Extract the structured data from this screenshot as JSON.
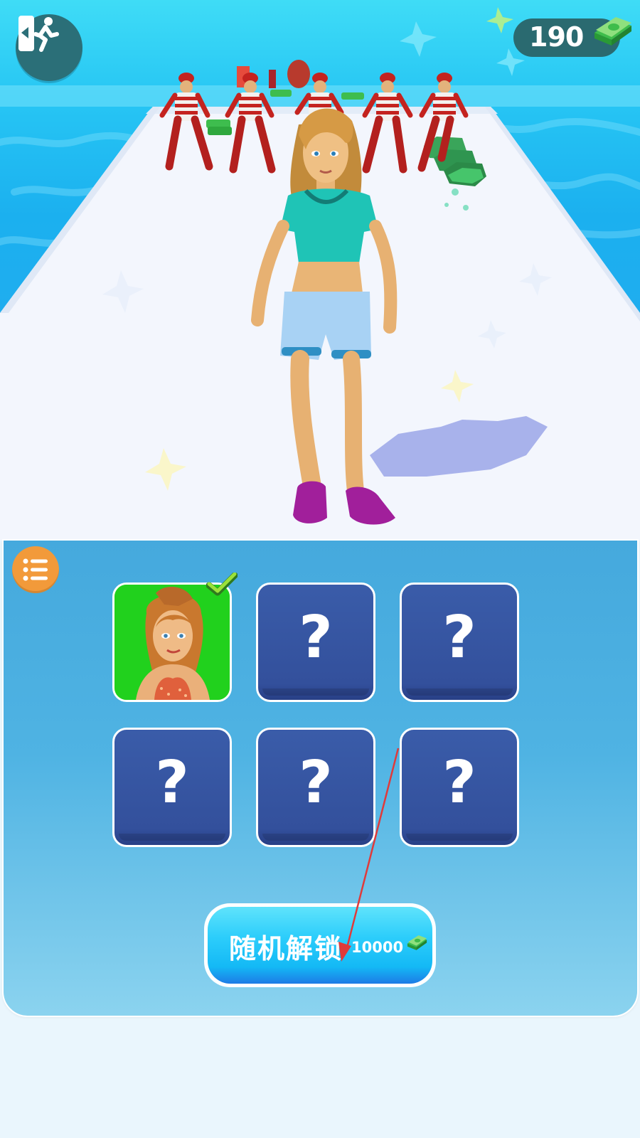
{
  "hud": {
    "money": "190",
    "exit_icon": "exit-door-runner-icon",
    "money_icon": "cash-stack-icon"
  },
  "scene": {
    "player": "girl-teal-crop-top-denim-shorts",
    "enemies": 5,
    "enemy_style": "red-white-striped-thief"
  },
  "shop": {
    "menu_icon": "list-menu-icon",
    "slots": [
      {
        "state": "unlocked",
        "selected": true
      },
      {
        "state": "locked",
        "label": "?"
      },
      {
        "state": "locked",
        "label": "?"
      },
      {
        "state": "locked",
        "label": "?"
      },
      {
        "state": "locked",
        "label": "?"
      },
      {
        "state": "locked",
        "label": "?"
      }
    ],
    "unlock_button": {
      "label": "随机解锁",
      "price": "10000",
      "price_icon": "cash-stack-icon"
    }
  },
  "colors": {
    "panel_top": "#45a9dd",
    "slot_locked": "#33509c",
    "slot_unlocked": "#21d11d",
    "unlock_button": "#14b9f5",
    "menu_button": "#f29a3a",
    "hud_pill": "#2a6a70",
    "annotation_arrow": "#e03a3a"
  }
}
